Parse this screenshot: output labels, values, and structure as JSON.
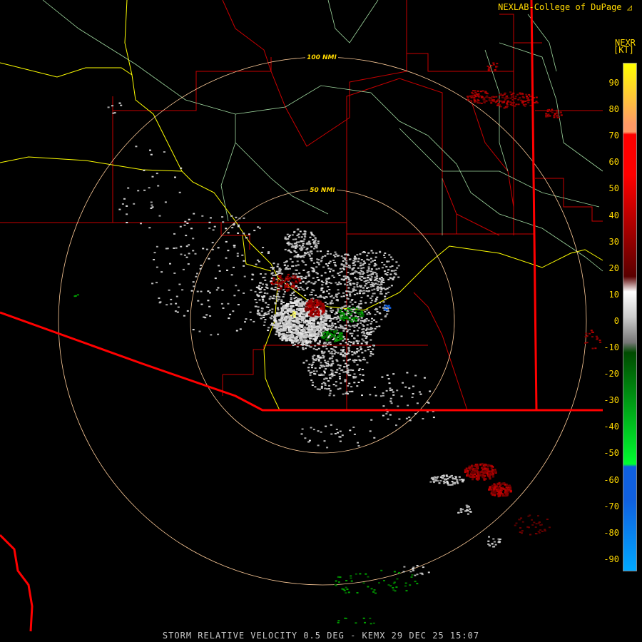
{
  "header": {
    "credit": "NEXLAB-College of DuPage",
    "credit_icon": "cod-logo-icon",
    "product": "NEXR",
    "units": "[KT]"
  },
  "caption": "STORM RELATIVE VELOCITY 0.5 DEG - KEMX 29 DEC 25 15:07",
  "rings": [
    {
      "label": "100 NMI"
    },
    {
      "label": "50 NMI"
    }
  ],
  "legend": {
    "ticks": [
      "90",
      "80",
      "70",
      "60",
      "50",
      "40",
      "30",
      "20",
      "10",
      "0",
      "-10",
      "-20",
      "-30",
      "-40",
      "-50",
      "-60",
      "-70",
      "-80",
      "-90"
    ],
    "range": [
      -95,
      95
    ],
    "colors": {
      "max": "#ffff00",
      "high_warm": "#ff9966",
      "red": "#ff0000",
      "dark_red": "#5a0000",
      "zero": "#cccccc",
      "dark_green": "#004a00",
      "green": "#00ff30",
      "blue": "#1060e0",
      "cyan": "#00a8ff"
    }
  },
  "map_colors": {
    "county_lines": "#c80000",
    "state_border": "#ff0000",
    "highways": "#ffff00",
    "rivers": "#9fd89f",
    "rings": "#ffcc99"
  }
}
